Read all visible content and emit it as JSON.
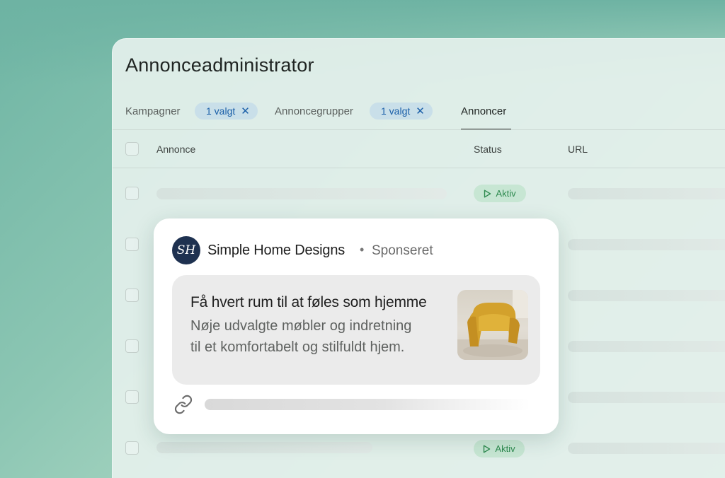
{
  "window": {
    "title": "Annonceadministrator"
  },
  "tabs": {
    "campaigns_label": "Kampagner",
    "campaigns_chip": "1 valgt",
    "adgroups_label": "Annoncegrupper",
    "adgroups_chip": "1 valgt",
    "ads_label": "Annoncer",
    "chip_close_icon": "close-icon"
  },
  "table": {
    "columns": [
      "Annonce",
      "Status",
      "URL"
    ],
    "rows": [
      {
        "status": "Aktiv"
      },
      {
        "status": ""
      },
      {
        "status": ""
      },
      {
        "status": ""
      },
      {
        "status": ""
      },
      {
        "status": "Aktiv"
      }
    ]
  },
  "ad_preview": {
    "avatar_initials": "SH",
    "advertiser": "Simple Home Designs",
    "separator": "•",
    "sponsored": "Sponseret",
    "headline": "Få hvert rum til at føles som hjemme",
    "description": "Nøje udvalgte møbler og indretning til et komfortabelt og stilfuldt hjem.",
    "image": "yellow-armchair-image",
    "link_icon": "link-icon"
  },
  "colors": {
    "chip_bg": "#c9dfe9",
    "chip_text": "#1a5fa8",
    "status_bg": "#c7e6d3",
    "status_text": "#2e8a4f",
    "avatar_bg": "#1e3150"
  }
}
